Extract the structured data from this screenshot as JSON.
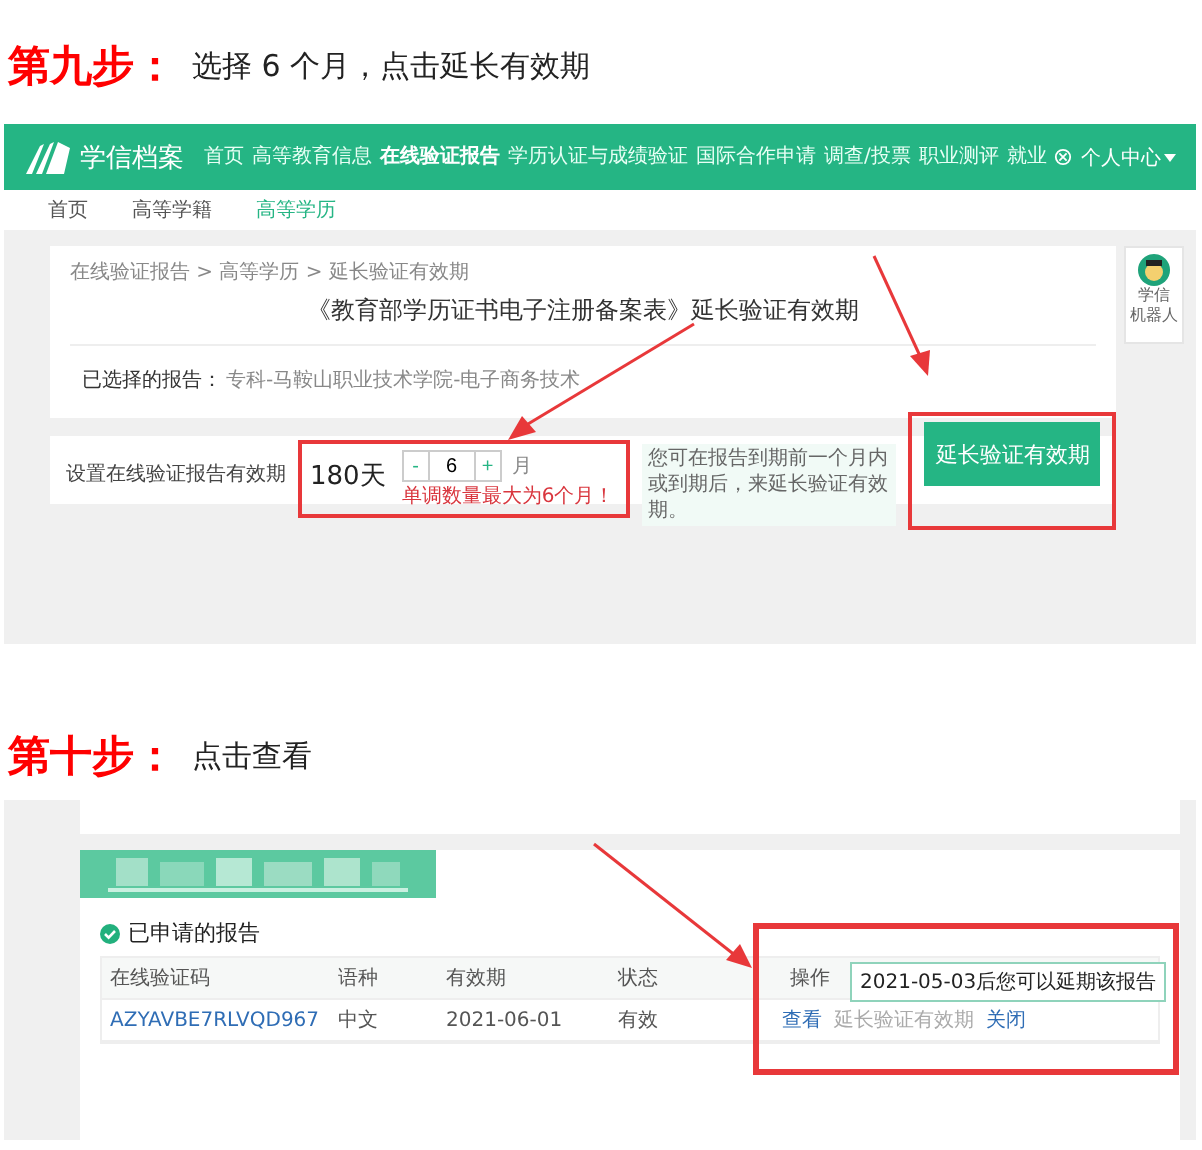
{
  "step_9": {
    "label": "第九步：",
    "instruction": "选择 6 个月，点击延长有效期"
  },
  "screenshot_1": {
    "logo": "学信档案",
    "nav": [
      {
        "label": "首页",
        "selected": false
      },
      {
        "label": "高等教育信息",
        "selected": false
      },
      {
        "label": "在线验证报告",
        "selected": true
      },
      {
        "label": "学历认证与成绩验证",
        "selected": false
      },
      {
        "label": "国际合作申请",
        "selected": false
      },
      {
        "label": "调查/投票",
        "selected": false
      },
      {
        "label": "职业测评",
        "selected": false
      },
      {
        "label": "就业",
        "selected": false
      }
    ],
    "user_menu": "个人中心",
    "subnav": [
      {
        "label": "首页",
        "selected": false
      },
      {
        "label": "高等学籍",
        "selected": false
      },
      {
        "label": "高等学历",
        "selected": true
      }
    ],
    "breadcrumb": "在线验证报告 > 高等学历 > 延长验证有效期",
    "title": "《教育部学历证书电子注册备案表》延长验证有效期",
    "selected_report_label": "已选择的报告：",
    "selected_report": "专科-马鞍山职业技术学院-电子商务技术",
    "validity_label": "设置在线验证报告有效期",
    "validity_days": "180天",
    "stepper": {
      "minus": "-",
      "value": "6",
      "plus": "+",
      "unit": "月"
    },
    "stepper_hint": "单调数量最大为6个月！",
    "info": "您可在报告到期前一个月内或到期后，来延长验证有效期。",
    "extend_button": "延长验证有效期",
    "robot": [
      "学信",
      "机器人"
    ]
  },
  "step_10": {
    "label": "第十步：",
    "instruction": "点击查看"
  },
  "screenshot_2": {
    "section_title": "已申请的报告",
    "columns": [
      "在线验证码",
      "语种",
      "有效期",
      "状态",
      "操作"
    ],
    "rows": [
      {
        "code": "AZYAVBE7RLVQD967",
        "language": "中文",
        "expiry": "2021-06-01",
        "status": "有效",
        "actions": [
          {
            "label": "查看",
            "disabled": false
          },
          {
            "label": "延长验证有效期",
            "disabled": true
          },
          {
            "label": "关闭",
            "disabled": false
          }
        ]
      }
    ],
    "tooltip": "2021-05-03后您可以延期该报告"
  }
}
